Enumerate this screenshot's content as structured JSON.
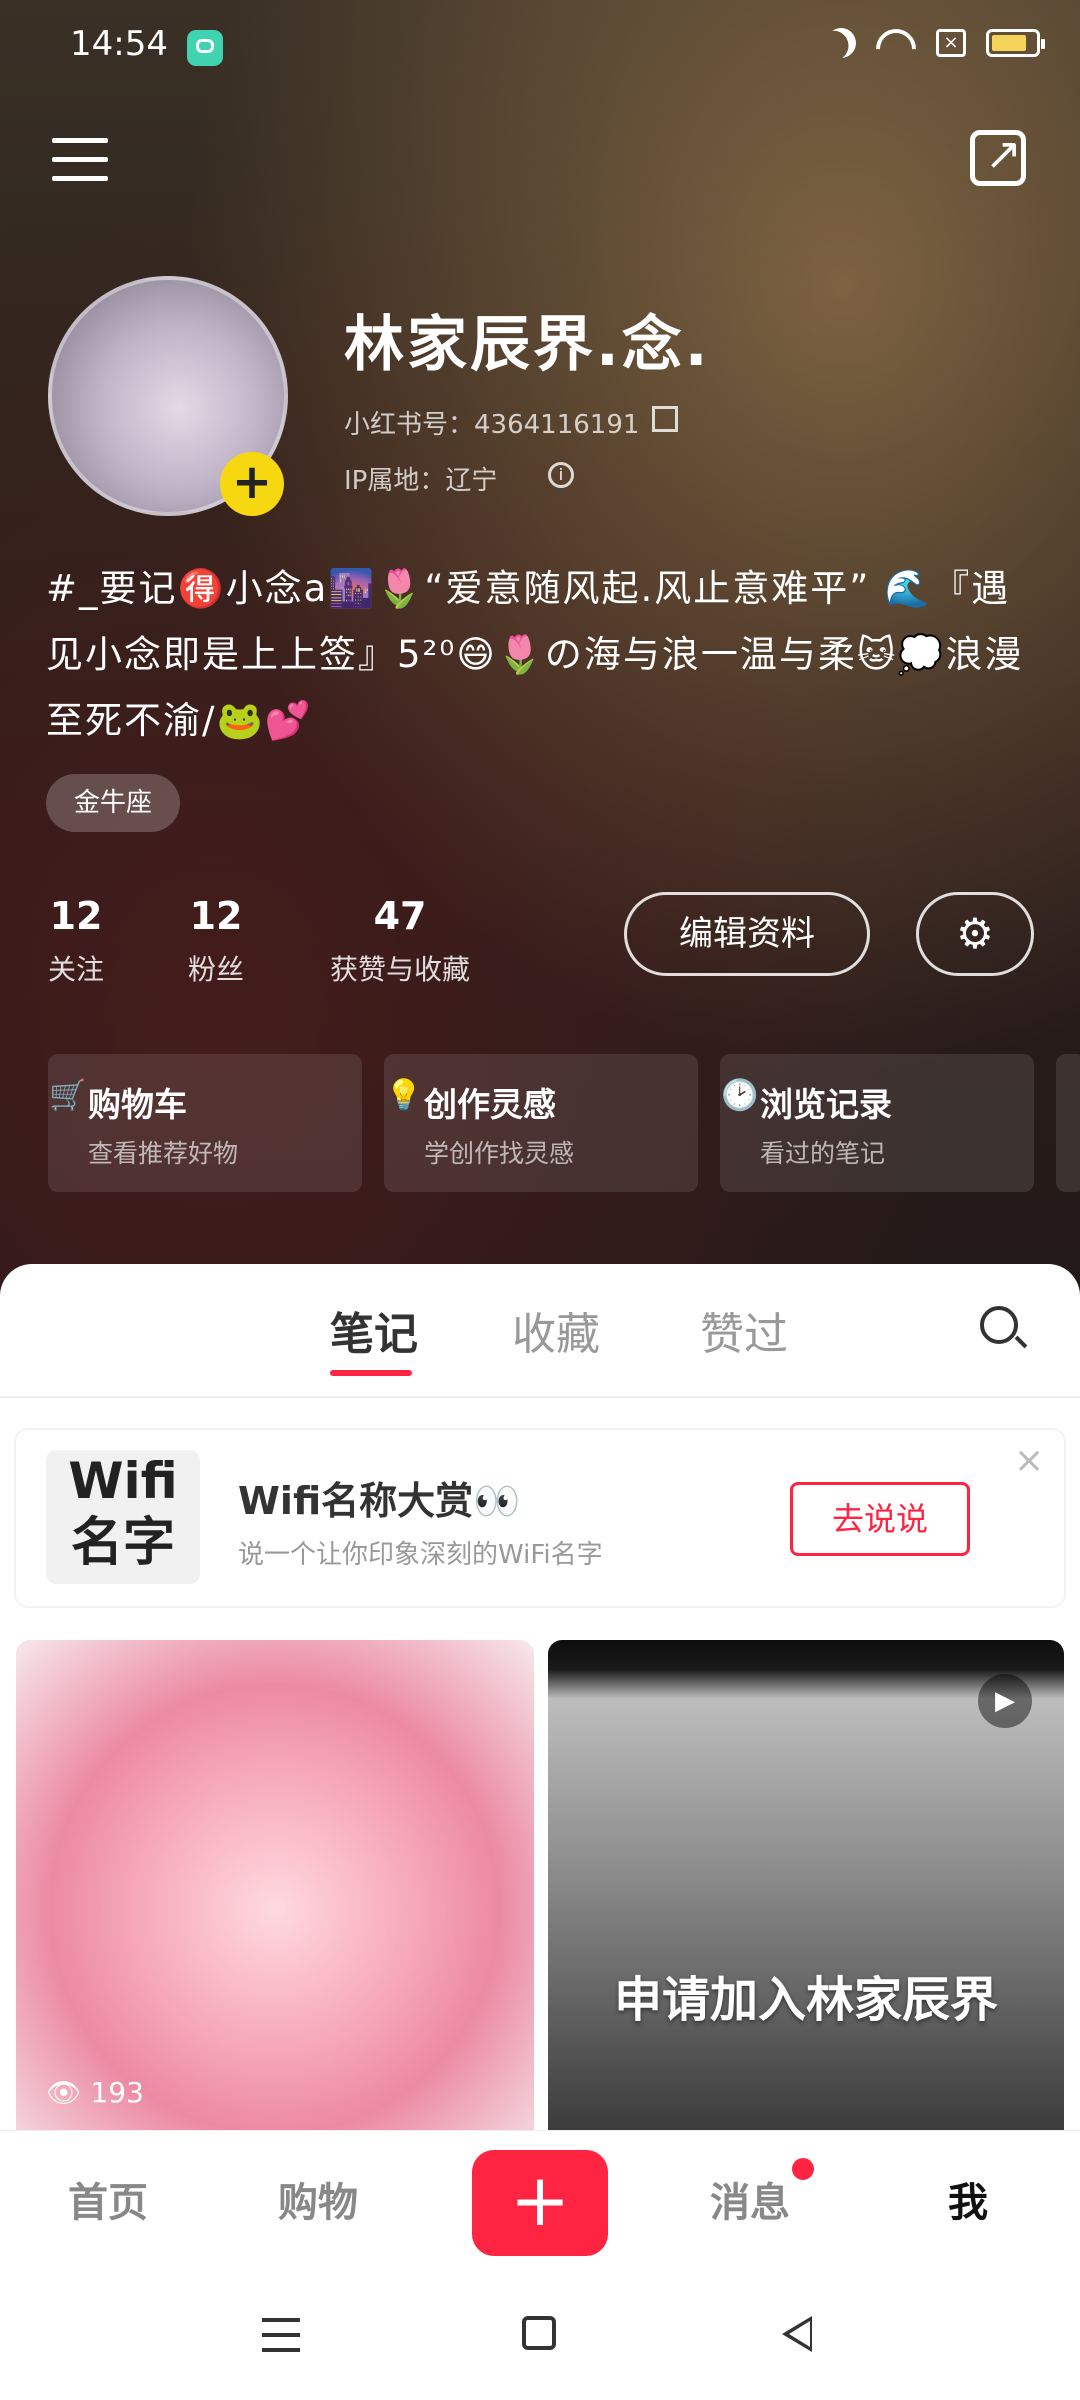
{
  "status_bar": {
    "time": "14:54",
    "icons": [
      "chat-app-icon",
      "moon-icon",
      "wifi-icon",
      "sim-off-icon",
      "battery-icon"
    ]
  },
  "header": {
    "menu_icon": "hamburger-icon",
    "share_icon": "share-icon"
  },
  "profile": {
    "username": "林家辰界.念.",
    "red_id": "小红书号：4364116191",
    "ip_location": "IP属地：辽宁",
    "bio": "#_要记🉐小念a🌆🌷“爱意随风起.风止意难平” 🌊『遇见小念即是上上签』5²⁰😄🌷の海与浪一温与柔🐱💭浪漫至死不渝/🐸💕",
    "tag": "金牛座"
  },
  "stats": [
    {
      "value": "12",
      "label": "关注"
    },
    {
      "value": "12",
      "label": "粉丝"
    },
    {
      "value": "47",
      "label": "获赞与收藏"
    }
  ],
  "actions": {
    "edit_label": "编辑资料",
    "settings_icon": "gear-icon"
  },
  "cards": [
    {
      "icon": "cart-icon",
      "title": "购物车",
      "subtitle": "查看推荐好物"
    },
    {
      "icon": "lightbulb-icon",
      "title": "创作灵感",
      "subtitle": "学创作找灵感"
    },
    {
      "icon": "clock-icon",
      "title": "浏览记录",
      "subtitle": "看过的笔记"
    }
  ],
  "tabs": [
    {
      "label": "笔记",
      "active": true
    },
    {
      "label": "收藏",
      "active": false
    },
    {
      "label": "赞过",
      "active": false
    }
  ],
  "banner": {
    "badge_line1": "Wifi",
    "badge_line2": "名字",
    "title": "Wifi名称大赏👀",
    "subtitle": "说一个让你印象深刻的WiFi名字",
    "button": "去说说"
  },
  "notes": [
    {
      "views": "193"
    },
    {
      "caption": "申请加入林家辰界"
    }
  ],
  "bottom_nav": [
    {
      "label": "首页"
    },
    {
      "label": "购物"
    },
    {
      "label": "+"
    },
    {
      "label": "消息"
    },
    {
      "label": "我"
    }
  ],
  "colors": {
    "accent": "#ff2442",
    "plus_badge": "#f5d80f"
  }
}
